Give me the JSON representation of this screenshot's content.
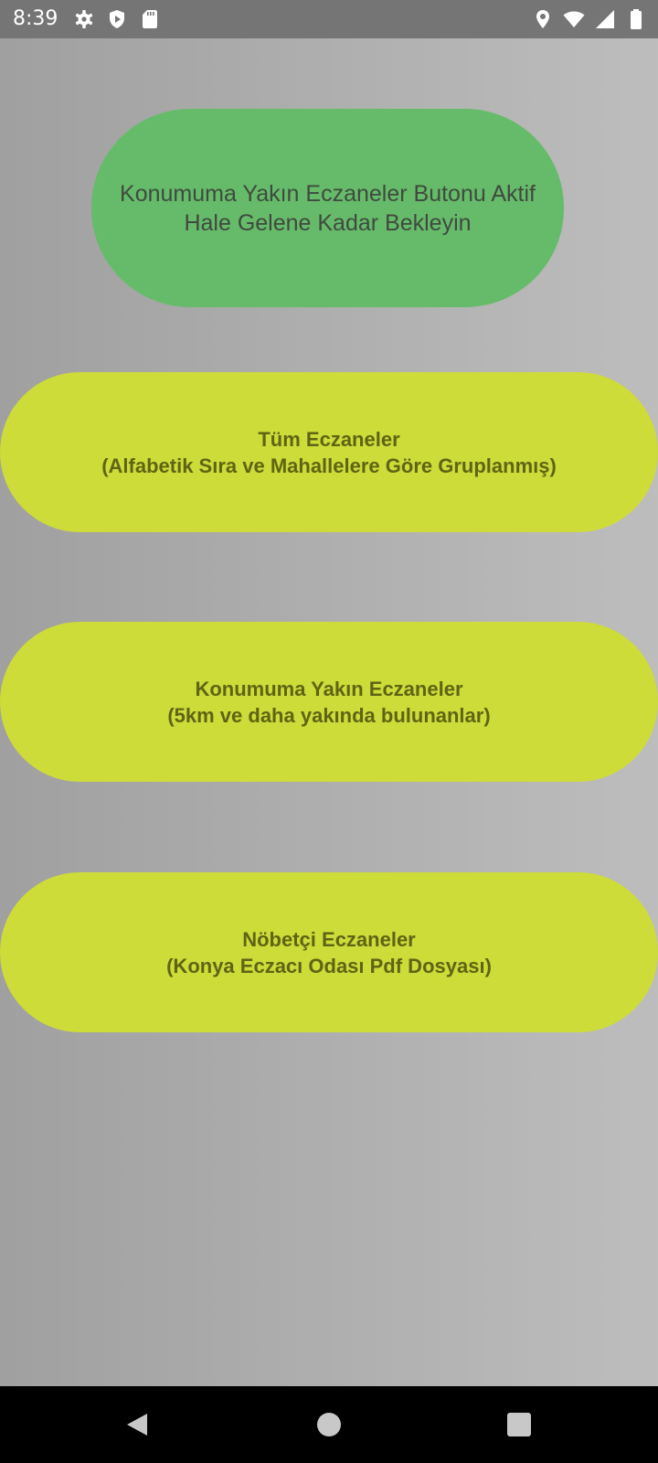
{
  "status_bar": {
    "time": "8:39",
    "left_icons": [
      "settings-gear-icon",
      "shield-icon",
      "sd-card-icon"
    ],
    "right_icons": [
      "location-pin-icon",
      "wifi-icon",
      "signal-icon",
      "battery-icon"
    ]
  },
  "colors": {
    "status_bar_bg": "#757575",
    "background_left": "#a0a0a0",
    "background_right": "#bdbdbd",
    "status_button_bg": "#66bb6a",
    "action_button_bg": "#cddc39",
    "action_button_text": "#5f6414",
    "nav_bar_bg": "#000000"
  },
  "main": {
    "status_button": {
      "line1": "Konumuma Yakın Eczaneler Butonu Aktif",
      "line2": "Hale Gelene Kadar Bekleyin"
    },
    "buttons": [
      {
        "line1": "Tüm Eczaneler",
        "line2": "(Alfabetik Sıra ve Mahallelere Göre Gruplanmış)"
      },
      {
        "line1": "Konumuma Yakın Eczaneler",
        "line2": "(5km ve daha yakında bulunanlar)"
      },
      {
        "line1": "Nöbetçi Eczaneler",
        "line2": "(Konya Eczacı Odası Pdf Dosyası)"
      }
    ]
  },
  "nav_bar": {
    "buttons": [
      "back-icon",
      "home-icon",
      "recents-icon"
    ]
  }
}
